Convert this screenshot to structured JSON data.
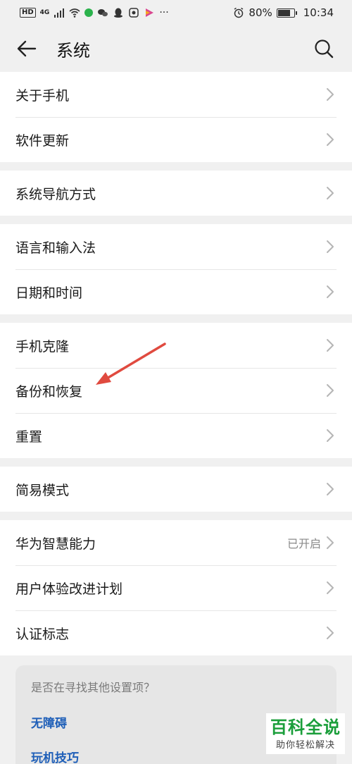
{
  "status_bar": {
    "hd": "HD",
    "signal": "4G",
    "battery": "80%",
    "battery_level": 0.8,
    "time": "10:34"
  },
  "header": {
    "title": "系统"
  },
  "groups": [
    {
      "items": [
        {
          "label": "关于手机"
        },
        {
          "label": "软件更新"
        }
      ]
    },
    {
      "items": [
        {
          "label": "系统导航方式"
        }
      ]
    },
    {
      "items": [
        {
          "label": "语言和输入法"
        },
        {
          "label": "日期和时间"
        }
      ]
    },
    {
      "items": [
        {
          "label": "手机克隆"
        },
        {
          "label": "备份和恢复"
        },
        {
          "label": "重置"
        }
      ]
    },
    {
      "items": [
        {
          "label": "简易模式"
        }
      ]
    },
    {
      "items": [
        {
          "label": "华为智慧能力",
          "status": "已开启"
        },
        {
          "label": "用户体验改进计划"
        },
        {
          "label": "认证标志"
        }
      ]
    }
  ],
  "card": {
    "title": "是否在寻找其他设置项？",
    "links": [
      "无障碍",
      "玩机技巧"
    ]
  },
  "watermark": {
    "title": "百科全说",
    "subtitle": "助你轻松解决"
  },
  "colors": {
    "link": "#1f5fb8",
    "arrow": "#e04a3f",
    "watermark_green": "#1a9e3a"
  }
}
